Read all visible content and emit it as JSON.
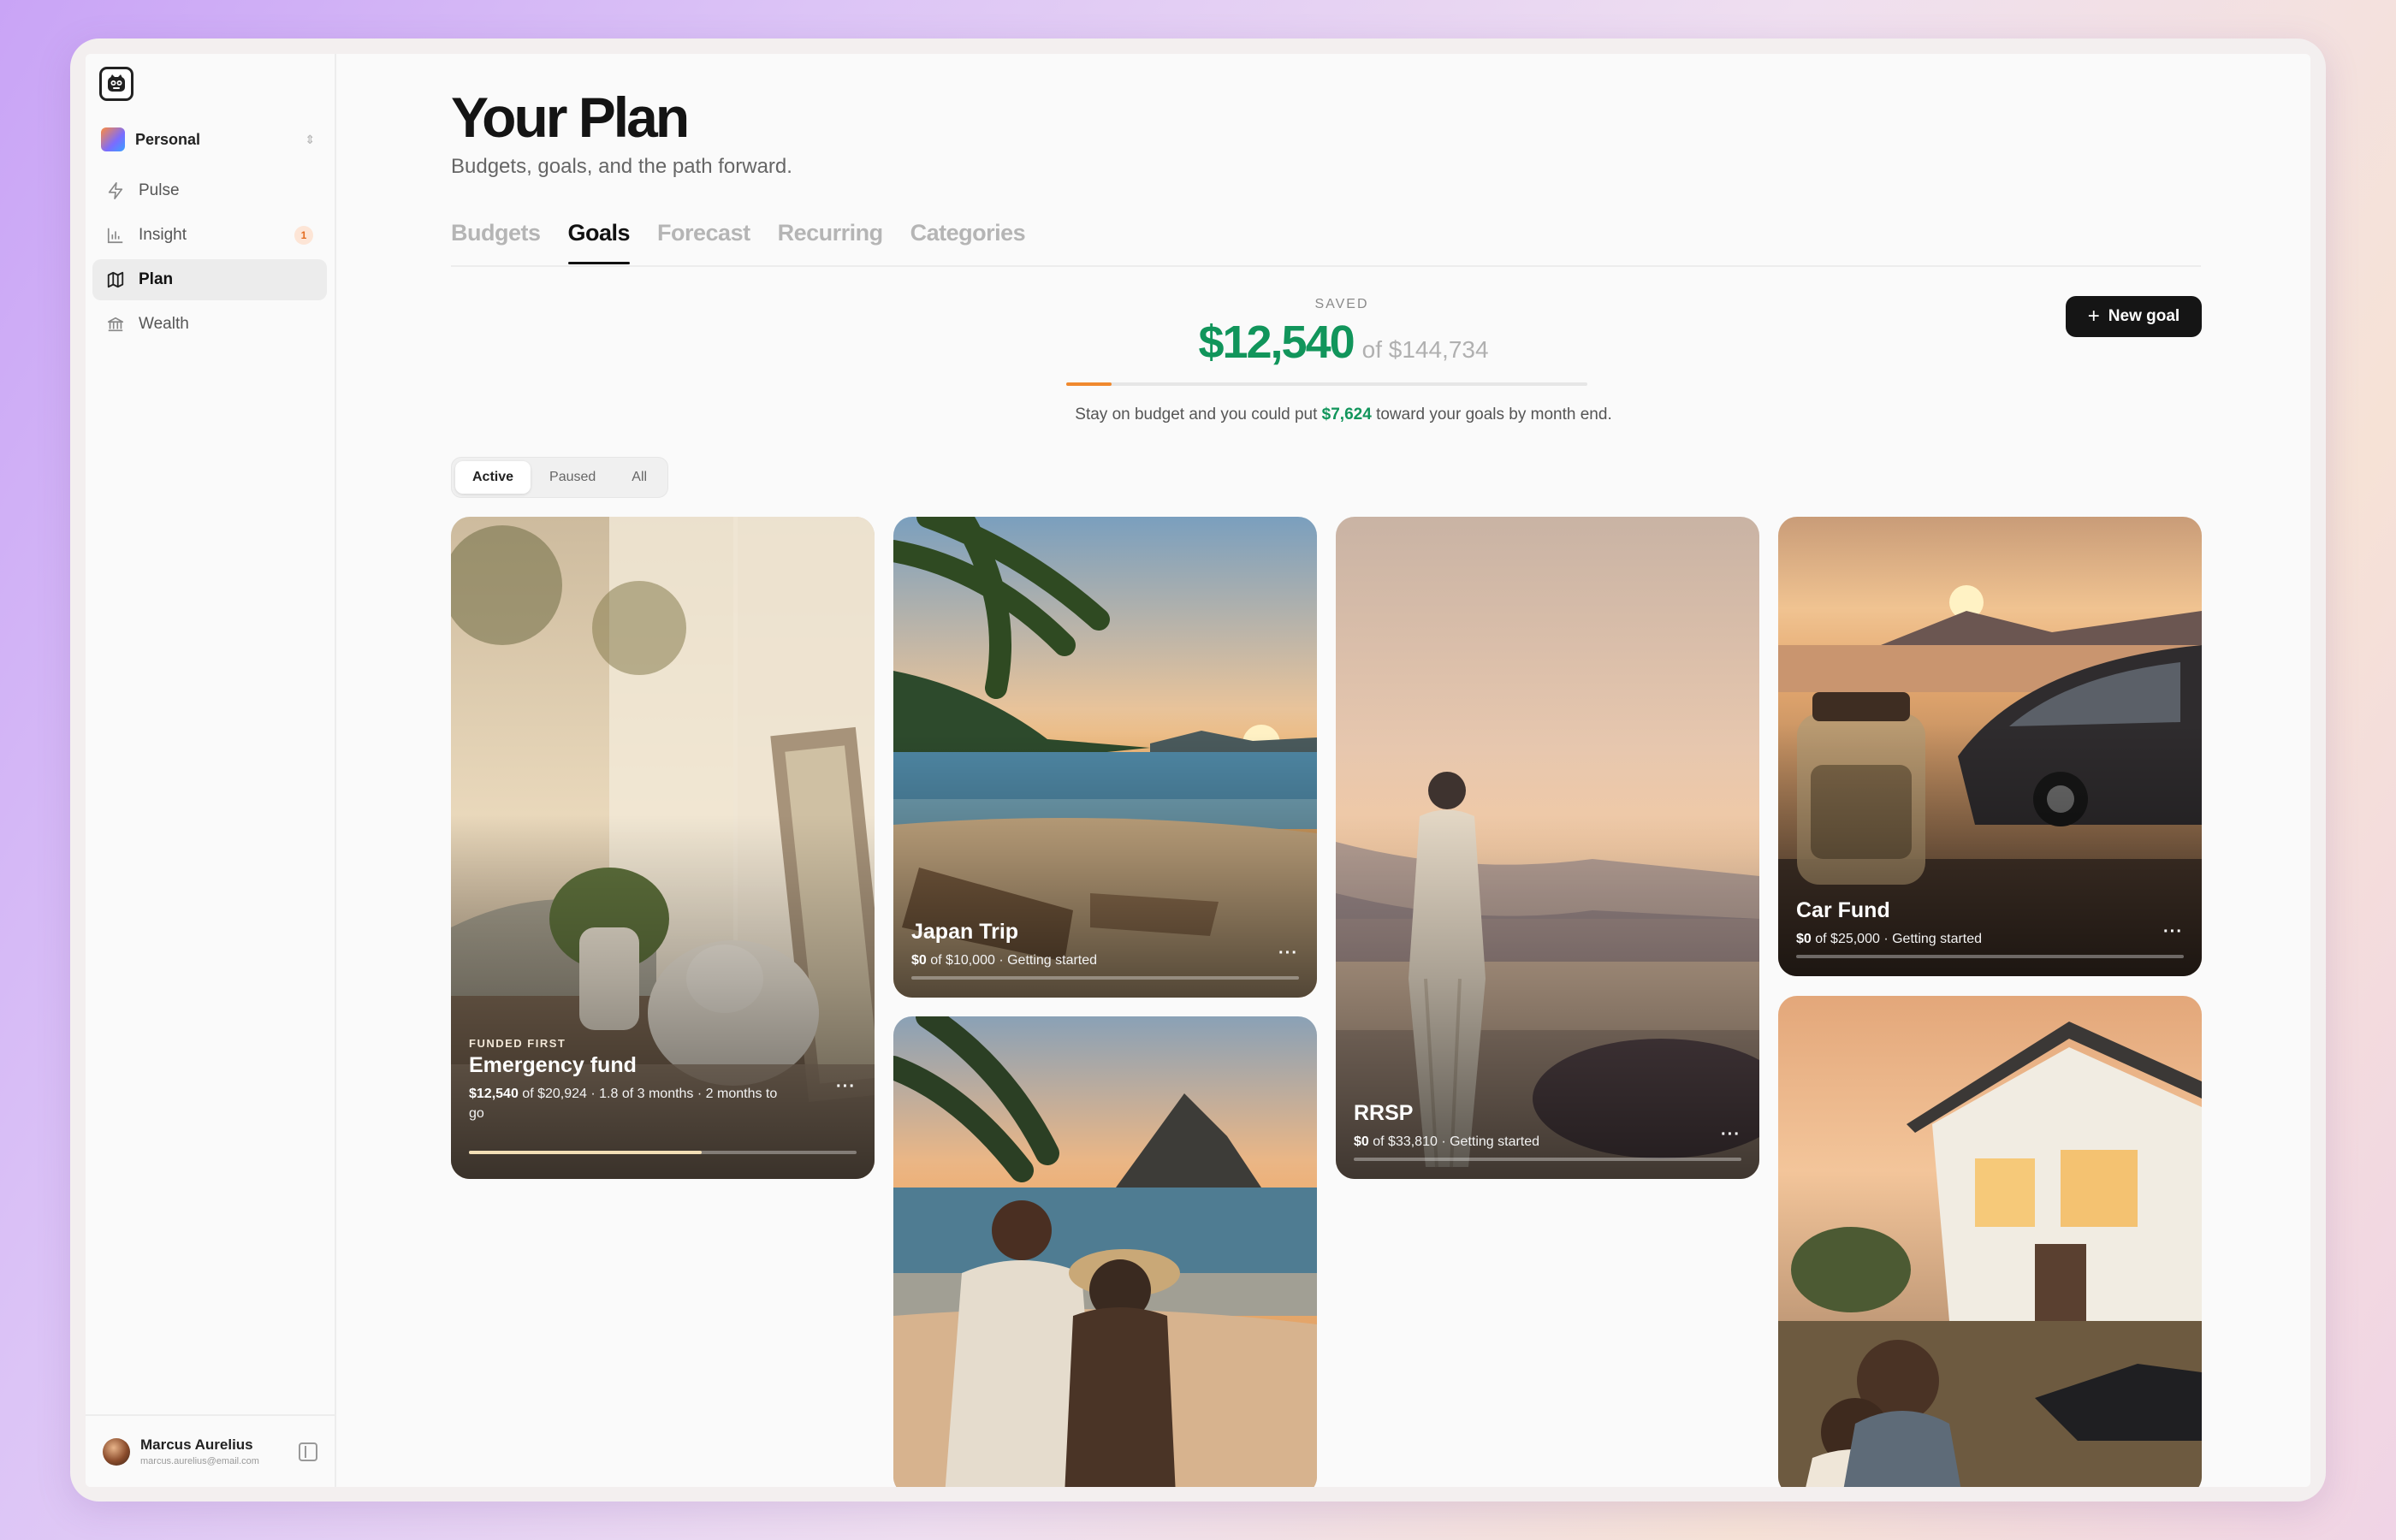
{
  "workspace": {
    "name": "Personal"
  },
  "nav": [
    {
      "label": "Pulse",
      "icon": "bolt-icon"
    },
    {
      "label": "Insight",
      "icon": "bar-chart-icon",
      "badge": "1"
    },
    {
      "label": "Plan",
      "icon": "map-icon",
      "active": true
    },
    {
      "label": "Wealth",
      "icon": "bank-icon"
    }
  ],
  "user": {
    "name": "Marcus Aurelius",
    "email": "marcus.aurelius@email.com"
  },
  "page": {
    "title": "Your Plan",
    "subtitle": "Budgets, goals, and the path forward."
  },
  "tabs": [
    "Budgets",
    "Goals",
    "Forecast",
    "Recurring",
    "Categories"
  ],
  "active_tab": "Goals",
  "summary": {
    "saved_label": "SAVED",
    "saved_amount": "$12,540",
    "saved_total": "of $144,734",
    "saved_fraction": 0.087,
    "hint_prefix": "Stay on budget and you could put",
    "hint_amount": "$7,624",
    "hint_suffix": "toward your goals by month end."
  },
  "actions": {
    "new_goal": "New goal"
  },
  "filters": [
    "Active",
    "Paused",
    "All"
  ],
  "active_filter": "Active",
  "goals": [
    {
      "overline": "FUNDED FIRST",
      "name": "Emergency fund",
      "amount": "$12,540",
      "detail": "of $20,924 · 1.8 of 3 months · 2 months to go",
      "progress": 0.6
    },
    {
      "name": "Japan Trip",
      "amount": "$0",
      "detail": "of $10,000 · Getting started",
      "progress": 0
    },
    {
      "name": "RRSP",
      "amount": "$0",
      "detail": "of $33,810 · Getting started",
      "progress": 0
    },
    {
      "name": "Car Fund",
      "amount": "$0",
      "detail": "of $25,000 · Getting started",
      "progress": 0
    },
    {
      "name": "",
      "amount": "",
      "detail": "",
      "progress": 0
    },
    {
      "name": "",
      "amount": "",
      "detail": "",
      "progress": 0
    }
  ],
  "more_label": "···",
  "colors": {
    "accent_green": "#11955b",
    "progress_orange": "#f0892e",
    "button_dark": "#151515"
  }
}
